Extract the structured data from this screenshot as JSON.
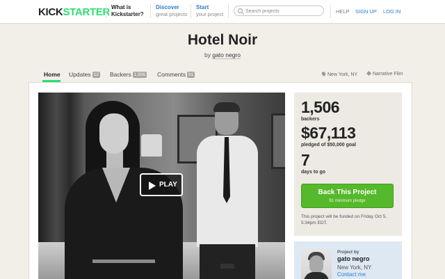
{
  "nav": {
    "logo_part1": "KICK",
    "logo_part2": "STARTER",
    "what_title": "What is",
    "what_sub": "Kickstarter?",
    "discover_title": "Discover",
    "discover_sub": "great projects",
    "start_title": "Start",
    "start_sub": "your project",
    "search_placeholder": "Search projects",
    "help": "HELP",
    "signup": "SIGN UP",
    "login": "LOG IN"
  },
  "project": {
    "title": "Hotel Noir",
    "by": "by",
    "creator": "gato negro"
  },
  "tabs": [
    {
      "label": "Home"
    },
    {
      "label": "Updates",
      "count": "12"
    },
    {
      "label": "Backers",
      "count": "1,506"
    },
    {
      "label": "Comments",
      "count": "61"
    }
  ],
  "meta": {
    "location": "New York, NY",
    "category": "Narrative Film"
  },
  "video": {
    "play_label": "PLAY"
  },
  "stats": {
    "backers": "1,506",
    "backers_label": "backers",
    "pledged": "$67,113",
    "pledged_label": "pledged of $50,000 goal",
    "days": "7",
    "days_label": "days to go",
    "back_button": "Back This Project",
    "minimum": "$1 minimum pledge",
    "funded_note": "This project will be funded on Friday Oct 5, 5:34pm EDT."
  },
  "creator_card": {
    "label": "Project by",
    "name": "gato negro",
    "location": "New York, NY",
    "contact": "Contact me"
  },
  "colors": {
    "brand_green": "#2bde73",
    "button_green": "#56b82b",
    "link_blue": "#2b7bd1"
  }
}
